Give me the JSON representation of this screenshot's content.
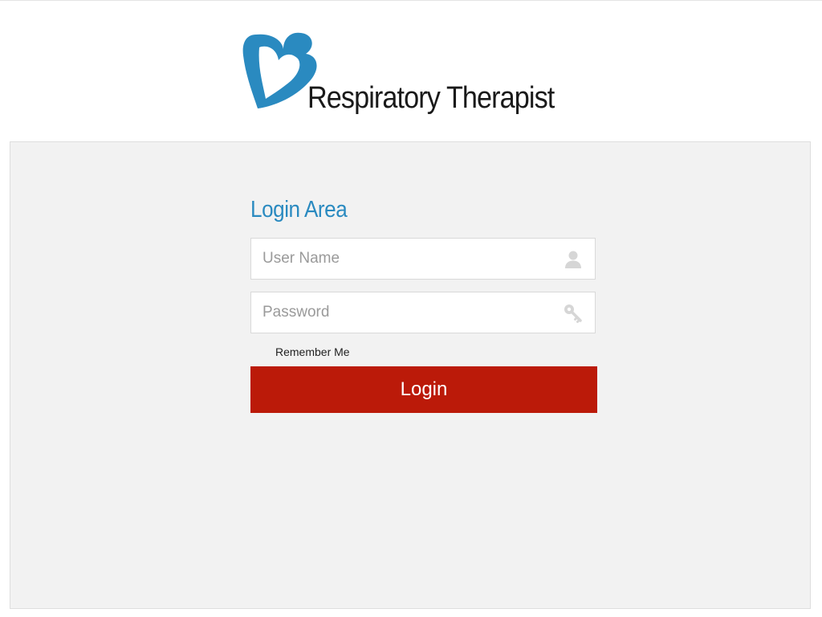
{
  "brand": {
    "name": "Respiratory Therapist",
    "logo_icon": "heart-b-logo-icon",
    "logo_color": "#2a8ac0"
  },
  "login": {
    "title": "Login Area",
    "username": {
      "placeholder": "User Name",
      "value": "",
      "icon": "user-icon"
    },
    "password": {
      "placeholder": "Password",
      "value": "",
      "icon": "key-icon"
    },
    "remember_label": "Remember Me",
    "remember_checked": false,
    "button_label": "Login"
  },
  "colors": {
    "accent": "#2a8ac0",
    "button": "#bb1a09",
    "panel_bg": "#f2f2f2",
    "icon_gray": "#d6d6d6"
  }
}
